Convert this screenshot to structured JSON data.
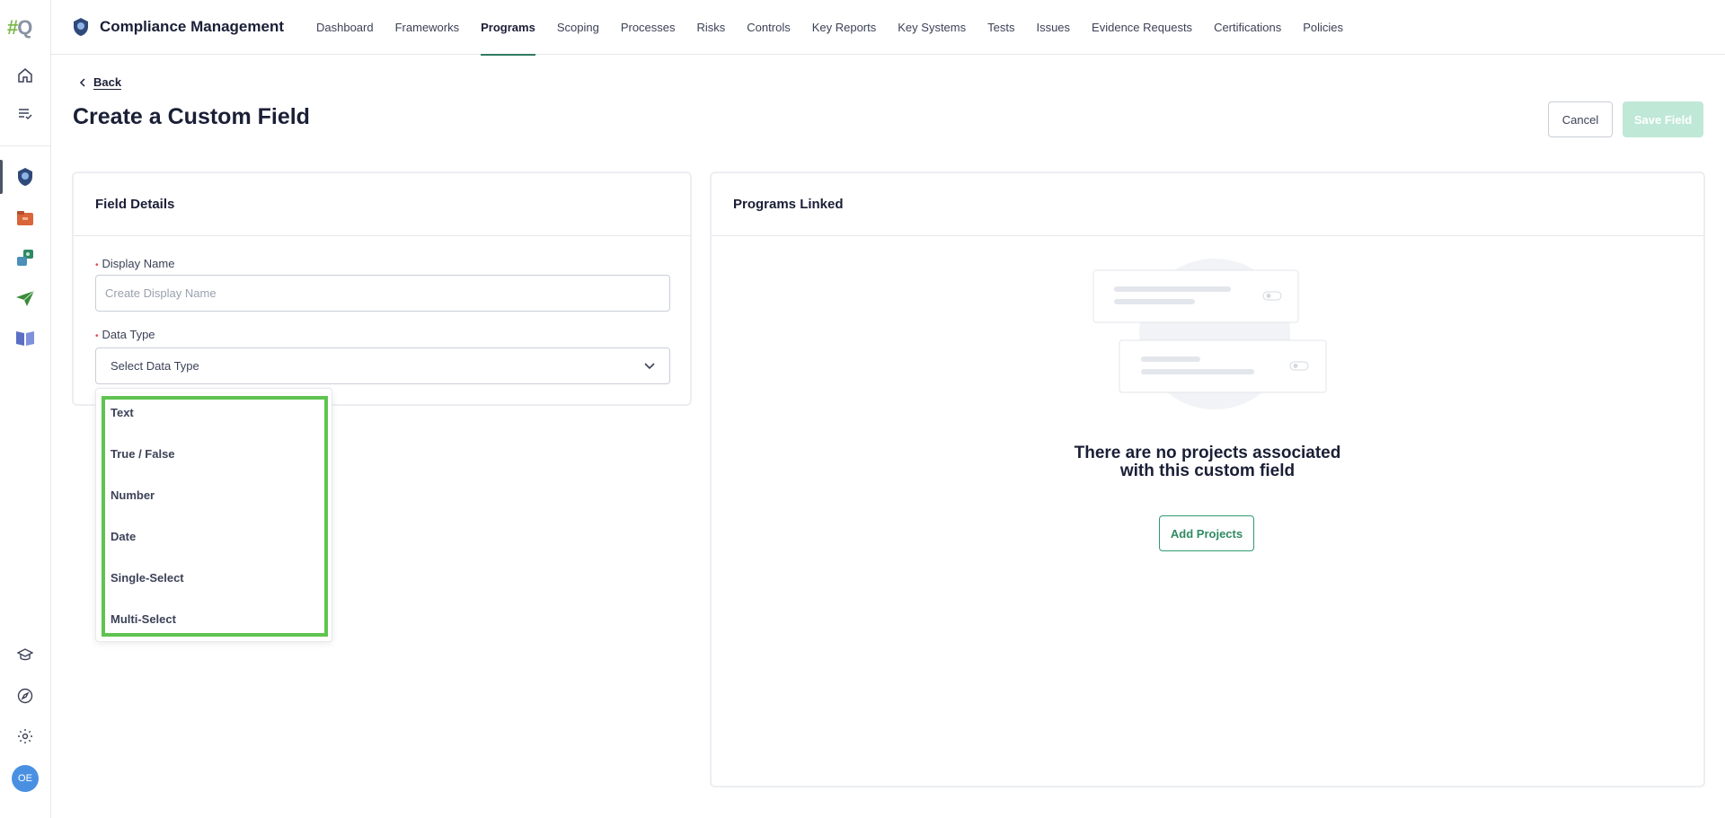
{
  "rail": {
    "logo_hash": "#",
    "logo_letter": "Q",
    "avatar_initials": "OE"
  },
  "topnav": {
    "app_title": "Compliance Management",
    "items": [
      {
        "label": "Dashboard",
        "active": false
      },
      {
        "label": "Frameworks",
        "active": false
      },
      {
        "label": "Programs",
        "active": true
      },
      {
        "label": "Scoping",
        "active": false
      },
      {
        "label": "Processes",
        "active": false
      },
      {
        "label": "Risks",
        "active": false
      },
      {
        "label": "Controls",
        "active": false
      },
      {
        "label": "Key Reports",
        "active": false
      },
      {
        "label": "Key Systems",
        "active": false
      },
      {
        "label": "Tests",
        "active": false
      },
      {
        "label": "Issues",
        "active": false
      },
      {
        "label": "Evidence Requests",
        "active": false
      },
      {
        "label": "Certifications",
        "active": false
      },
      {
        "label": "Policies",
        "active": false
      }
    ]
  },
  "header": {
    "back_label": "Back",
    "title": "Create a Custom Field",
    "cancel_label": "Cancel",
    "save_label": "Save Field"
  },
  "field_details": {
    "title": "Field Details",
    "display_name_label": "Display Name",
    "display_name_placeholder": "Create Display Name",
    "display_name_value": "",
    "data_type_label": "Data Type",
    "data_type_placeholder": "Select Data Type",
    "data_type_options": [
      "Text",
      "True / False",
      "Number",
      "Date",
      "Single-Select",
      "Multi-Select"
    ]
  },
  "programs_linked": {
    "title": "Programs Linked",
    "empty_line1": "There are no projects associated",
    "empty_line2": "with this custom field",
    "add_label": "Add Projects"
  },
  "colors": {
    "accent": "#2f7a63",
    "save_disabled": "#bfe8d6",
    "highlight": "#5fc44f",
    "avatar": "#4a90e2"
  }
}
